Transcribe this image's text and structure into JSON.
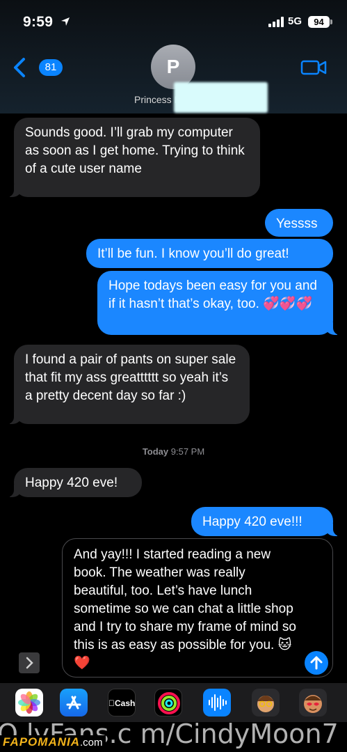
{
  "status_bar": {
    "time": "9:59",
    "network": "5G",
    "battery": "94"
  },
  "header": {
    "back_count": "81",
    "avatar_initial": "P",
    "contact_name": "Princess K"
  },
  "messages": [
    {
      "direction": "received",
      "text": "Sounds good. I’ll grab my computer as soon as I get home. Trying to think of a cute user name"
    },
    {
      "direction": "sent",
      "text": "Yessss"
    },
    {
      "direction": "sent",
      "text": "It’ll be fun. I know you’ll do great!"
    },
    {
      "direction": "sent",
      "text": "Hope todays been easy for you and if it hasn’t that’s okay, too. 💞💞💞"
    },
    {
      "direction": "received",
      "text": "I found a pair of pants on super sale that fit my ass greatttttt so yeah it’s a pretty decent day so far :)"
    },
    {
      "direction": "received",
      "text": "Happy 420 eve!"
    },
    {
      "direction": "sent",
      "text": "Happy 420 eve!!!"
    }
  ],
  "timestamp": {
    "day": "Today",
    "time": "9:57 PM"
  },
  "compose": {
    "text": "And yay!!! I started reading a new book. The weather was really beautiful, too. Let’s have lunch sometime so we can chat a little shop and I try to share my frame of mind so this is as easy as possible for you. 🐱❤️"
  },
  "app_drawer": {
    "apps": [
      "photos-icon",
      "app-store-icon",
      "apple-cash-icon",
      "activity-icon",
      "audio-message-icon",
      "memoji-icon",
      "memoji-stickers-icon"
    ],
    "cash_label": "Cash"
  },
  "watermark": {
    "url": "O lyFans.c m/CindyMoon7",
    "brand": "FAPOMANIA",
    "tld": ".com"
  },
  "colors": {
    "sent_bubble": "#1b87ff",
    "received_bubble": "#262628",
    "accent": "#0a84ff"
  }
}
